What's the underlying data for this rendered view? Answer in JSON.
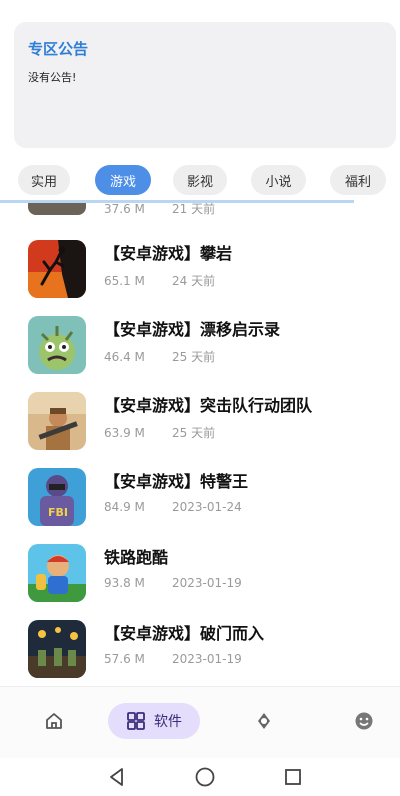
{
  "announcement": {
    "title": "专区公告",
    "body": "没有公告!"
  },
  "tabs": [
    {
      "label": "实用",
      "active": false
    },
    {
      "label": "游戏",
      "active": true
    },
    {
      "label": "影视",
      "active": false
    },
    {
      "label": "小说",
      "active": false
    },
    {
      "label": "福利",
      "active": false
    }
  ],
  "partial_item": {
    "size": "37.6 M",
    "date": "21 天前"
  },
  "items": [
    {
      "name": "【安卓游戏】攀岩",
      "size": "65.1 M",
      "date": "24 天前",
      "icon": "climbing-game-icon"
    },
    {
      "name": "【安卓游戏】漂移启示录",
      "size": "46.4 M",
      "date": "25 天前",
      "icon": "zombie-drift-game-icon"
    },
    {
      "name": "【安卓游戏】突击队行动团队",
      "size": "63.9 M",
      "date": "25 天前",
      "icon": "commando-game-icon"
    },
    {
      "name": "【安卓游戏】特警王",
      "size": "84.9 M",
      "date": "2023-01-24",
      "icon": "swat-game-icon"
    },
    {
      "name": "铁路跑酷",
      "size": "93.8 M",
      "date": "2023-01-19",
      "icon": "subway-surfer-icon"
    },
    {
      "name": "【安卓游戏】破门而入",
      "size": "57.6 M",
      "date": "2023-01-19",
      "icon": "breach-game-icon"
    }
  ],
  "bottom_nav": {
    "home_icon": "home-icon",
    "software_label": "软件",
    "software_icon": "grid-icon",
    "discover_icon": "compass-icon",
    "profile_icon": "smiley-icon"
  },
  "colors": {
    "accent": "#4d8ee6",
    "title_blue": "#2f7fd6",
    "nav_pill": "#e4ddfb"
  }
}
